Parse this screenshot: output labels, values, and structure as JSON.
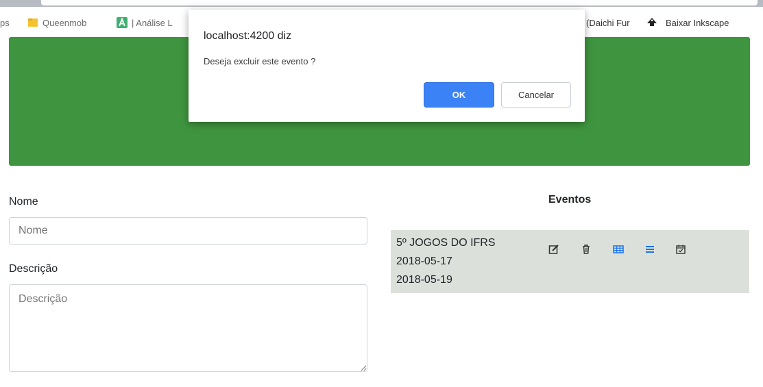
{
  "bookmarks": {
    "items": [
      {
        "label": "ps",
        "icon": "apps-icon"
      },
      {
        "label": "Queenmob",
        "icon": "folder-icon"
      },
      {
        "label": "| Análise L",
        "icon": "a-logo-icon"
      },
      {
        "label": "(Daichi Fur",
        "icon": ""
      },
      {
        "label": "Baixar Inkscape",
        "icon": "inkscape-icon"
      }
    ]
  },
  "dialog": {
    "title": "localhost:4200 diz",
    "message": "Deseja excluir este evento ?",
    "ok_label": "OK",
    "cancel_label": "Cancelar"
  },
  "form": {
    "nome_label": "Nome",
    "nome_placeholder": "Nome",
    "nome_value": "",
    "descricao_label": "Descrição",
    "descricao_placeholder": "Descrição",
    "descricao_value": ""
  },
  "events": {
    "title": "Eventos",
    "items": [
      {
        "name": "5º JOGOS DO IFRS",
        "start": "2018-05-17",
        "end": "2018-05-19",
        "actions": [
          "edit-icon",
          "trash-icon",
          "table-icon",
          "list-icon",
          "calendar-check-icon"
        ]
      }
    ]
  },
  "colors": {
    "hero": "#3f953f",
    "primary_button": "#3b82f6",
    "event_row_bg": "#dbe0db",
    "action_blue": "#1a73e8"
  }
}
